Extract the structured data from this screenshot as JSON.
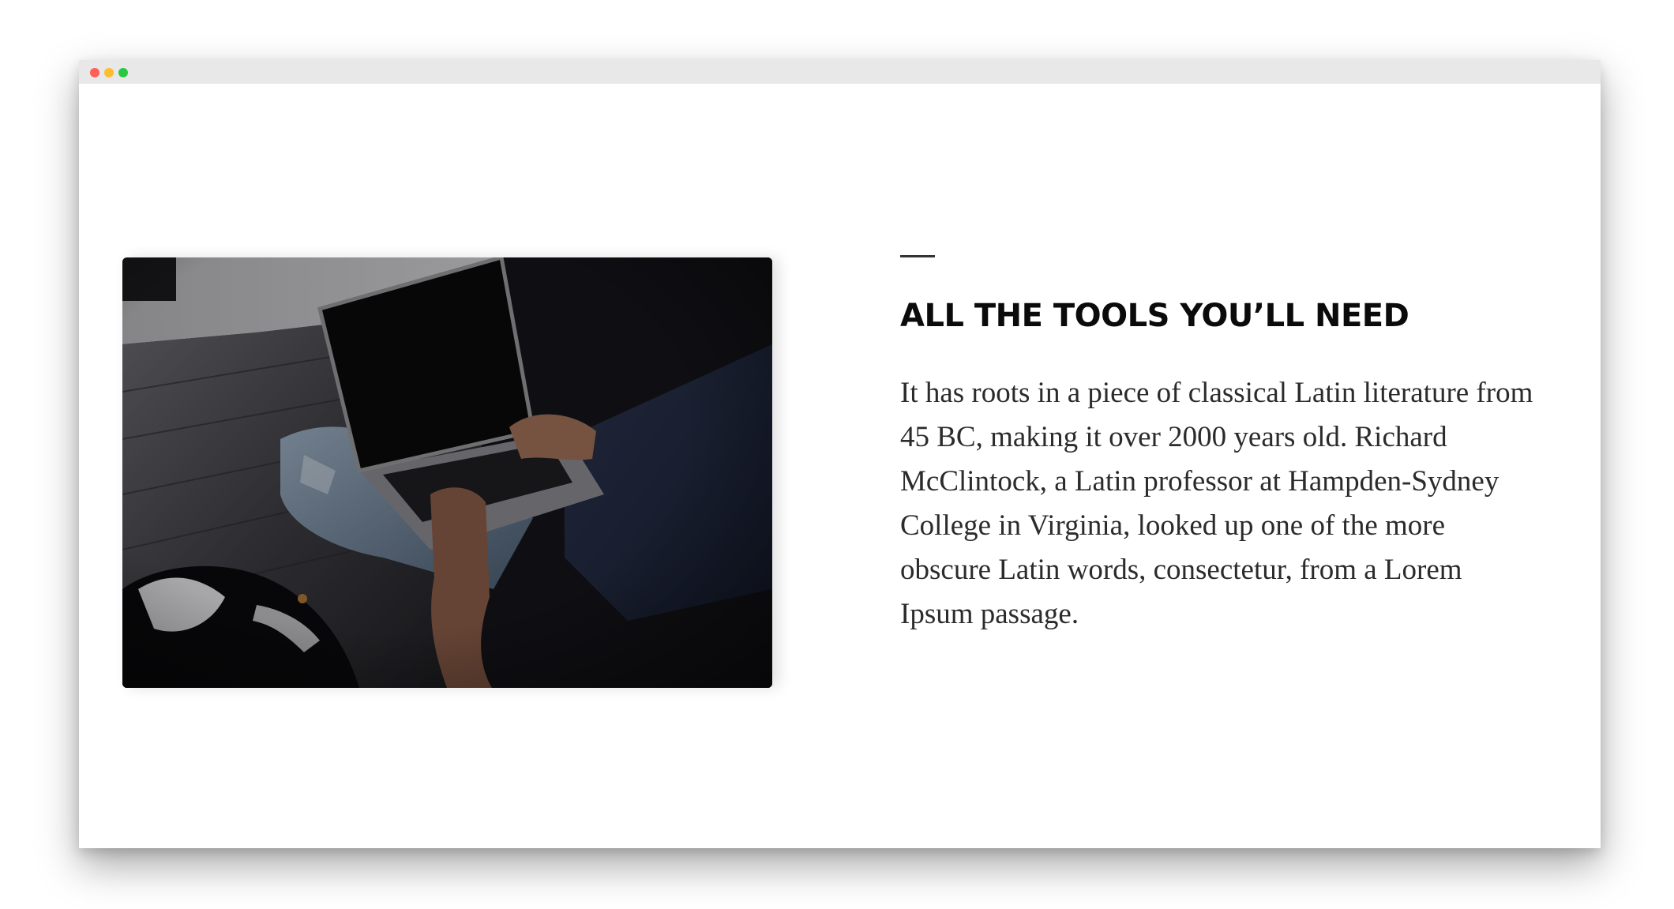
{
  "window": {
    "controls": [
      {
        "name": "close",
        "color": "#ff5f57"
      },
      {
        "name": "minimize",
        "color": "#febc2e"
      },
      {
        "name": "maximize",
        "color": "#28c840"
      }
    ]
  },
  "feature": {
    "image": {
      "icon": "photo-person-laptop-dog"
    },
    "heading": "ALL THE TOOLS YOU’LL NEED",
    "body": "It has roots in a piece of classical Latin literature from 45 BC, making it over 2000 years old. Richard McClintock, a Latin professor at Hampden-Sydney College in Virginia, looked up one of the more obscure Latin words, consectetur, from a Lorem Ipsum passage."
  },
  "colors": {
    "heading": "#0b0b0b",
    "body": "#2b2b2b",
    "accent_dash": "#333333",
    "titlebar": "#e8e8e8"
  }
}
